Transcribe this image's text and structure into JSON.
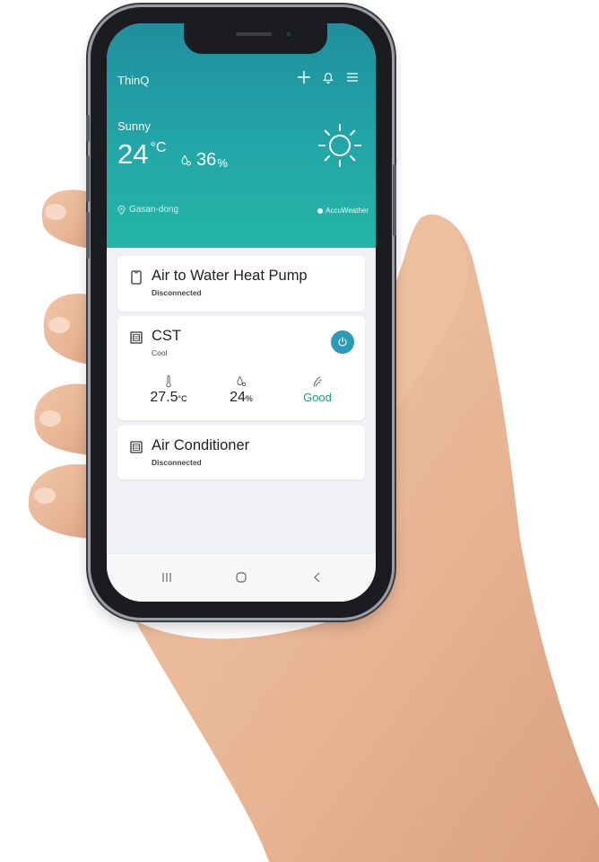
{
  "app": {
    "title": "ThinQ"
  },
  "weather": {
    "condition": "Sunny",
    "temperature": "24",
    "temp_unit": "°C",
    "humidity": "36",
    "humidity_unit": "%",
    "location": "Gasan-dong",
    "provider": "AccuWeather",
    "icon": "sun-icon"
  },
  "devices": [
    {
      "name": "Air to Water Heat Pump",
      "status": "Disconnected",
      "icon": "phone-device-icon"
    },
    {
      "name": "CST",
      "status": "Cool",
      "icon": "hvac-icon",
      "stats": {
        "temperature": "27.5",
        "temperature_unit": "°C",
        "humidity": "24",
        "humidity_unit": "%",
        "air_quality": "Good"
      }
    },
    {
      "name": "Air Conditioner",
      "status": "Disconnected",
      "icon": "hvac-icon"
    }
  ],
  "colors": {
    "header_start": "#1f8f9d",
    "header_end": "#25b5a6",
    "accent": "#2b9bb8",
    "good": "#1ea07a"
  },
  "nav": {
    "icons": [
      "recent-apps-icon",
      "home-icon",
      "back-icon"
    ]
  }
}
